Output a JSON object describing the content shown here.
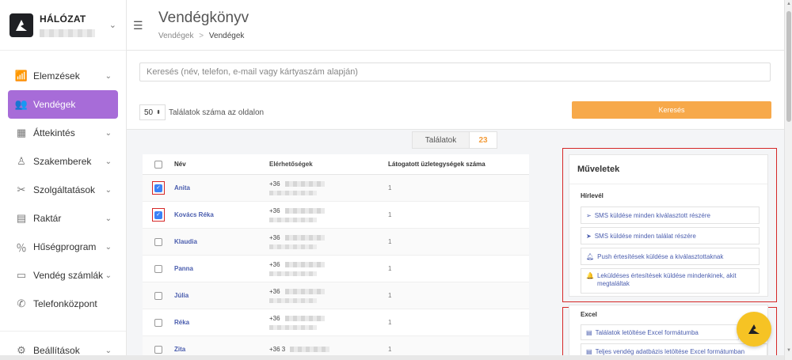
{
  "brand": {
    "name": "HÁLÓZAT"
  },
  "sidebar": {
    "items": [
      {
        "label": "Elemzések",
        "icon": "chart-icon",
        "glyph": "📶",
        "chev": "⌄"
      },
      {
        "label": "Vendégek",
        "icon": "users-icon",
        "glyph": "👥",
        "chev": ""
      },
      {
        "label": "Áttekintés",
        "icon": "grid-icon",
        "glyph": "▦",
        "chev": "⌄"
      },
      {
        "label": "Szakemberek",
        "icon": "person-icon",
        "glyph": "♙",
        "chev": "⌄"
      },
      {
        "label": "Szolgáltatások",
        "icon": "scissors-icon",
        "glyph": "✂",
        "chev": "⌄"
      },
      {
        "label": "Raktár",
        "icon": "warehouse-icon",
        "glyph": "▤",
        "chev": "⌄"
      },
      {
        "label": "Hűségprogram",
        "icon": "percent-icon",
        "glyph": "％",
        "chev": "⌄"
      },
      {
        "label": "Vendég számlák",
        "icon": "inbox-icon",
        "glyph": "▭",
        "chev": "⌄"
      },
      {
        "label": "Telefonközpont",
        "icon": "phone-icon",
        "glyph": "✆",
        "chev": ""
      }
    ],
    "settings": {
      "label": "Beállítások",
      "icon": "gear-icon",
      "glyph": "⚙",
      "chev": "⌄"
    }
  },
  "header": {
    "title": "Vendégkönyv",
    "breadcrumb": {
      "parent": "Vendégek",
      "sep": ">",
      "current": "Vendégek"
    }
  },
  "search": {
    "placeholder": "Keresés (név, telefon, e-mail vagy kártyaszám alapján)",
    "per_page_value": "50",
    "per_page_label": "Találatok száma az oldalon",
    "button_label": "Keresés"
  },
  "results": {
    "label": "Találatok",
    "count": "23"
  },
  "table": {
    "headers": {
      "name": "Név",
      "contact": "Elérhetőségek",
      "visits": "Látogatott üzletegységek száma"
    },
    "rows": [
      {
        "name": "Anita",
        "phone": "+36",
        "visits": "1",
        "checked": true
      },
      {
        "name": "Kovács Réka",
        "phone": "+36",
        "visits": "1",
        "checked": true
      },
      {
        "name": "Klaudia",
        "phone": "+36",
        "visits": "1",
        "checked": false
      },
      {
        "name": "Panna",
        "phone": "+36",
        "visits": "1",
        "checked": false
      },
      {
        "name": "Júlia",
        "phone": "+36",
        "visits": "1",
        "checked": false
      },
      {
        "name": "Réka",
        "phone": "+36",
        "visits": "1",
        "checked": false
      },
      {
        "name": "Zita",
        "phone": "+36 3",
        "visits": "1",
        "checked": false
      }
    ]
  },
  "operations": {
    "title": "Műveletek",
    "newsletter": {
      "title": "Hírlevél",
      "buttons": [
        {
          "label": "SMS küldése minden kiválasztott részére",
          "icon": "send-icon"
        },
        {
          "label": "SMS küldése minden találat részére",
          "icon": "send-filled-icon"
        },
        {
          "label": "Push értesítések küldése a kiválasztottaknak",
          "icon": "bell-icon"
        },
        {
          "label": "Leküldéses értesítések küldése mindenkinek, akit megtaláltak",
          "icon": "bell-filled-icon"
        }
      ]
    },
    "excel": {
      "title": "Excel",
      "buttons": [
        {
          "label": "Találatok letöltése Excel formátumba",
          "icon": "file-icon"
        },
        {
          "label": "Teljes vendég adatbázis letöltése Excel formátumban",
          "icon": "file-icon"
        }
      ]
    }
  },
  "colors": {
    "accent": "#a76cd8",
    "orange": "#f7a94a",
    "highlight": "#d62828",
    "link": "#4a5dae",
    "fab": "#f6c324"
  }
}
